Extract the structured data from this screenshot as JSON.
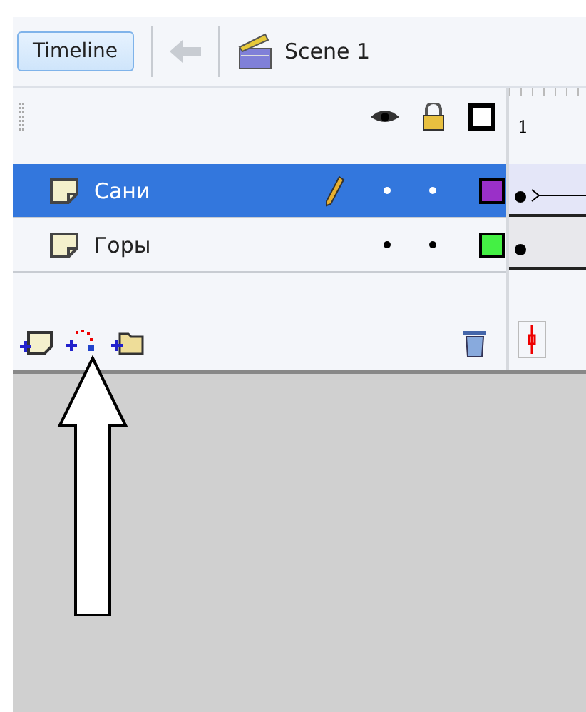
{
  "toolbar": {
    "timeline_button": "Timeline",
    "scene": "Scene 1"
  },
  "frame_ruler": {
    "label": "1"
  },
  "layers": [
    {
      "name": "Сани",
      "selected": true,
      "color": "#9a30c8",
      "tween": true
    },
    {
      "name": "Горы",
      "selected": false,
      "color": "#44f044",
      "tween": false
    }
  ]
}
